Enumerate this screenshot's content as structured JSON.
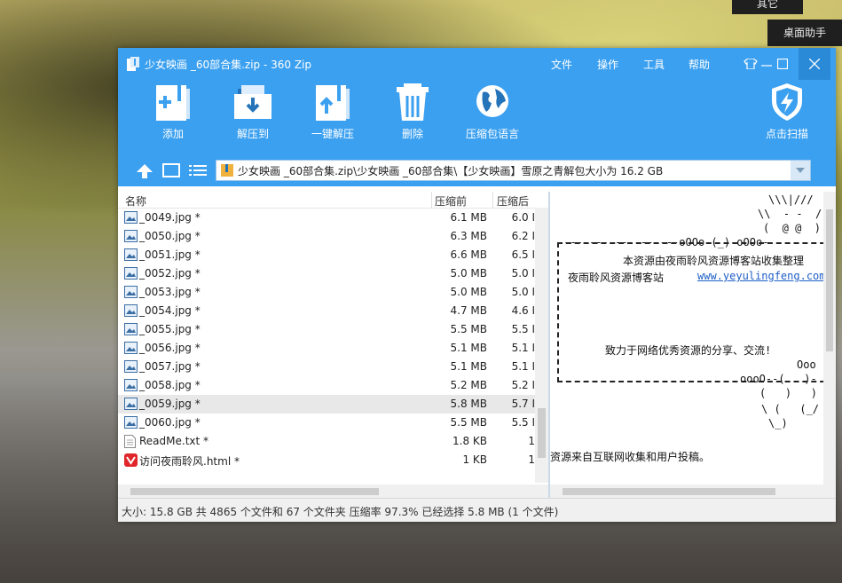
{
  "desktop": {
    "tab_top": "其它",
    "tab_assistant": "桌面助手"
  },
  "window": {
    "title": "少女映画 _60部合集.zip - 360 Zip",
    "menu": [
      "文件",
      "操作",
      "工具",
      "帮助"
    ]
  },
  "toolbar": {
    "add": "添加",
    "extract_to": "解压到",
    "one_click_extract": "一键解压",
    "delete": "删除",
    "language": "压缩包语言",
    "scan": "点击扫描"
  },
  "address": {
    "path": "少女映画 _60部合集.zip\\少女映画 _60部合集\\【少女映画】雪原之青解包大小为 16.2 GB"
  },
  "columns": {
    "name": "名称",
    "size_before": "压缩前",
    "size_after": "压缩后"
  },
  "files": [
    {
      "name": "_0049.jpg *",
      "before": "6.1 MB",
      "after": "6.0 I"
    },
    {
      "name": "_0050.jpg *",
      "before": "6.3 MB",
      "after": "6.2 I"
    },
    {
      "name": "_0051.jpg *",
      "before": "6.6 MB",
      "after": "6.5 I"
    },
    {
      "name": "_0052.jpg *",
      "before": "5.0 MB",
      "after": "5.0 I"
    },
    {
      "name": "_0053.jpg *",
      "before": "5.0 MB",
      "after": "5.0 I"
    },
    {
      "name": "_0054.jpg *",
      "before": "4.7 MB",
      "after": "4.6 I"
    },
    {
      "name": "_0055.jpg *",
      "before": "5.5 MB",
      "after": "5.5 I"
    },
    {
      "name": "_0056.jpg *",
      "before": "5.1 MB",
      "after": "5.1 I"
    },
    {
      "name": "_0057.jpg *",
      "before": "5.1 MB",
      "after": "5.1 I"
    },
    {
      "name": "_0058.jpg *",
      "before": "5.2 MB",
      "after": "5.2 I"
    },
    {
      "name": "_0059.jpg *",
      "before": "5.8 MB",
      "after": "5.7 I"
    },
    {
      "name": "_0060.jpg *",
      "before": "5.5 MB",
      "after": "5.5 I"
    },
    {
      "name": "ReadMe.txt *",
      "before": "1.8 KB",
      "after": "1"
    },
    {
      "name": "访问夜雨聆风.html *",
      "before": "1 KB",
      "after": "1"
    }
  ],
  "preview": {
    "art1": "\\\\\\|///",
    "art2": "\\\\  - -  /",
    "art3": "(  @ @  )",
    "border_top": "-------------------oOOo-(_)-oOOo-",
    "line_collect": "本资源由夜雨聆风资源博客站收集整理",
    "site_name": "夜雨聆风资源博客站",
    "site_url": "www.yeyulingfeng.com",
    "slogan": "致力于网络优秀资源的分享、交流!",
    "art4": "Ooo",
    "art5": "oooO--(   )-",
    "art6": "(   )   )",
    "art7": "\\ (   (_/",
    "art8": "\\_)",
    "footer": "资源来自互联网收集和用户投稿。"
  },
  "status": {
    "text": "大小: 15.8 GB 共 4865 个文件和 67 个文件夹 压缩率 97.3% 已经选择 5.8 MB (1 个文件)"
  }
}
